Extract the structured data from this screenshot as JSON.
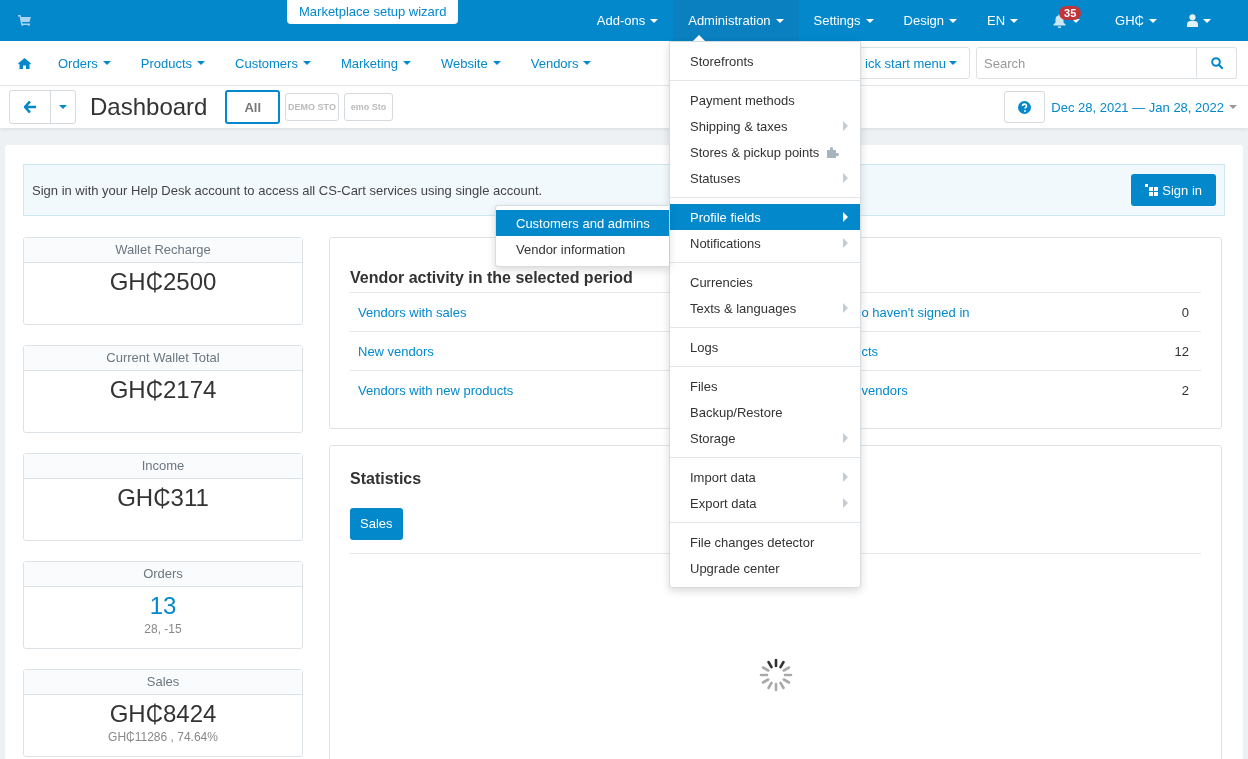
{
  "top_bar": {
    "wizard_tab": "Marketplace setup wizard",
    "menus": [
      {
        "kind": "text",
        "label": "Add-ons",
        "selected": false
      },
      {
        "kind": "text",
        "label": "Administration",
        "selected": true
      },
      {
        "kind": "text",
        "label": "Settings",
        "selected": false
      },
      {
        "kind": "text",
        "label": "Design",
        "selected": false
      },
      {
        "kind": "text",
        "label": "EN",
        "selected": false
      },
      {
        "kind": "bell",
        "badge": "35",
        "selected": false
      },
      {
        "kind": "text",
        "label": "GH₵",
        "selected": false
      },
      {
        "kind": "user",
        "selected": false
      }
    ]
  },
  "nav_bar": {
    "items": [
      "Orders",
      "Products",
      "Customers",
      "Marketing",
      "Website",
      "Vendors"
    ],
    "quick_start": "ick start menu",
    "search": {
      "placeholder": "Search"
    }
  },
  "toolbar": {
    "title": "Dashboard",
    "stores": [
      {
        "label": "All",
        "selected": true
      },
      {
        "label": "DEMO STO",
        "selected": false
      },
      {
        "label": "emo Sto",
        "selected": false
      }
    ],
    "date_range": "Dec 28, 2021 — Jan 28, 2022"
  },
  "notice": {
    "text": "Sign in with your Help Desk account to access all CS-Cart services using single account.",
    "button": "Sign in"
  },
  "stat_cards": [
    {
      "kind": "plain",
      "title": "Wallet Recharge",
      "value": "GH₵2500"
    },
    {
      "kind": "plain",
      "title": "Current Wallet Total",
      "value": "GH₵2174"
    },
    {
      "kind": "plain",
      "title": "Income",
      "value": "GH₵311"
    },
    {
      "kind": "link",
      "title": "Orders",
      "value": "13",
      "sub": "28, -15"
    },
    {
      "kind": "plain",
      "title": "Sales",
      "value": "GH₵8424",
      "sub": "GH₵11286 , 74.64%"
    }
  ],
  "vendor_activity": {
    "title": "Vendor activity in the selected period",
    "rows": [
      {
        "left": "Vendors with sales",
        "right": "o haven't signed in",
        "value": "0"
      },
      {
        "left": "New vendors",
        "right": "cts",
        "value": "12"
      },
      {
        "left": "Vendors with new products",
        "right": "vendors",
        "value": "2"
      }
    ]
  },
  "statistics": {
    "title": "Statistics",
    "tabs": [
      {
        "label": "Sales",
        "selected": true
      }
    ]
  },
  "admin_menu": {
    "groups": [
      [
        {
          "label": "Storefronts",
          "submenu": false,
          "addon": false,
          "selected": false
        }
      ],
      [
        {
          "label": "Payment methods",
          "submenu": false,
          "addon": false,
          "selected": false
        },
        {
          "label": "Shipping & taxes",
          "submenu": true,
          "addon": false,
          "selected": false
        },
        {
          "label": "Stores & pickup points",
          "submenu": false,
          "addon": true,
          "selected": false
        },
        {
          "label": "Statuses",
          "submenu": true,
          "addon": false,
          "selected": false
        }
      ],
      [
        {
          "label": "Profile fields",
          "submenu": true,
          "addon": false,
          "selected": true
        },
        {
          "label": "Notifications",
          "submenu": true,
          "addon": false,
          "selected": false
        }
      ],
      [
        {
          "label": "Currencies",
          "submenu": false,
          "addon": false,
          "selected": false
        },
        {
          "label": "Texts & languages",
          "submenu": true,
          "addon": false,
          "selected": false
        }
      ],
      [
        {
          "label": "Logs",
          "submenu": false,
          "addon": false,
          "selected": false
        }
      ],
      [
        {
          "label": "Files",
          "submenu": false,
          "addon": false,
          "selected": false
        },
        {
          "label": "Backup/Restore",
          "submenu": false,
          "addon": false,
          "selected": false
        },
        {
          "label": "Storage",
          "submenu": true,
          "addon": false,
          "selected": false
        }
      ],
      [
        {
          "label": "Import data",
          "submenu": true,
          "addon": false,
          "selected": false
        },
        {
          "label": "Export data",
          "submenu": true,
          "addon": false,
          "selected": false
        }
      ],
      [
        {
          "label": "File changes detector",
          "submenu": false,
          "addon": false,
          "selected": false
        },
        {
          "label": "Upgrade center",
          "submenu": false,
          "addon": false,
          "selected": false
        }
      ]
    ],
    "submenu": [
      {
        "label": "Customers and admins",
        "selected": true
      },
      {
        "label": "Vendor information",
        "selected": false
      }
    ]
  }
}
